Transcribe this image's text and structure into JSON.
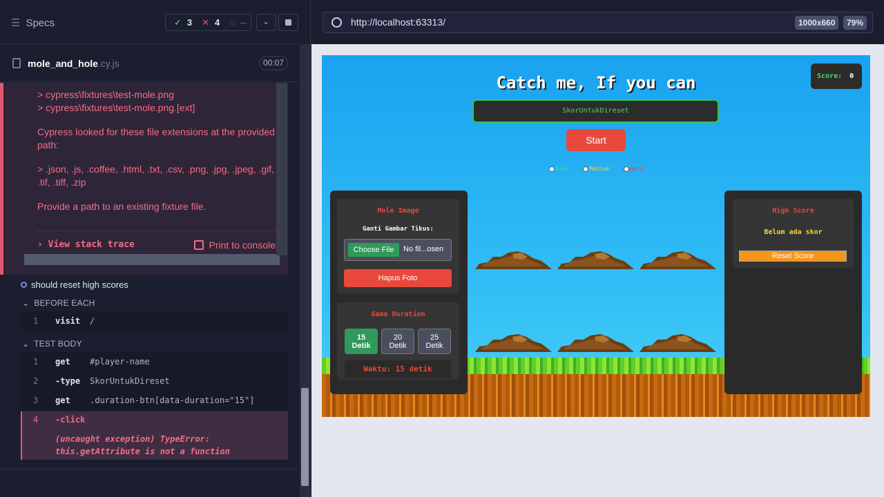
{
  "runner": {
    "specs_label": "Specs",
    "passed": "3",
    "failed": "4",
    "pending": "--",
    "file_name": "mole_and_hole",
    "file_ext": ".cy.js",
    "duration": "00:07",
    "error": {
      "lines": [
        "> cypress\\fixtures\\test-mole.png",
        "> cypress\\fixtures\\test-mole.png.[ext]"
      ],
      "para1": "Cypress looked for these file extensions at the provided path:",
      "para2": "> .json, .js, .coffee, .html, .txt, .csv, .png, .jpg, .jpeg, .gif, .tif, .tiff, .zip",
      "para3": "Provide a path to an existing fixture file.",
      "view_stack": "View stack trace",
      "print_console": "Print to console"
    },
    "test_title": "should reset high scores",
    "before_each_label": "BEFORE EACH",
    "test_body_label": "TEST BODY",
    "before_cmds": [
      {
        "n": "1",
        "cmd": "visit",
        "arg": "/"
      }
    ],
    "body_cmds": [
      {
        "n": "1",
        "cmd": "get",
        "arg": "#player-name"
      },
      {
        "n": "2",
        "cmd": "-type",
        "arg": "SkorUntukDireset"
      },
      {
        "n": "3",
        "cmd": "get",
        "arg": ".duration-btn[data-duration=\"15\"]"
      }
    ],
    "fail_cmd": {
      "n": "4",
      "cmd": "-click",
      "msg1": "(uncaught exception)  TypeError:",
      "msg2": "this.getAttribute is not a function"
    }
  },
  "browser": {
    "url": "http://localhost:63313/",
    "viewport": "1000x660",
    "zoom": "79%"
  },
  "app": {
    "title": "Catch me, If you can",
    "score_label": "Score:",
    "score_value": "0",
    "player_name": "SkorUntukDireset",
    "start_label": "Start",
    "difficulty": [
      {
        "label": "Easy",
        "color": "#2ee58a"
      },
      {
        "label": "Medium",
        "color": "#f5d442"
      },
      {
        "label": "Hard",
        "color": "#e8493c"
      }
    ],
    "mole_image_title": "Mole Image",
    "change_image_label": "Ganti Gambar Tikus:",
    "choose_file_label": "Choose File",
    "file_status": "No fil...osen",
    "delete_photo_label": "Hapus Foto",
    "game_duration_title": "Game Duration",
    "durations": [
      {
        "num": "15",
        "unit": "Detik"
      },
      {
        "num": "20",
        "unit": "Detik"
      },
      {
        "num": "25",
        "unit": "Detik"
      }
    ],
    "timer_text": "Waktu: 15 detik",
    "high_score_title": "High Score",
    "no_score_text": "Belum ada skor",
    "reset_score_label": "Reset Score"
  }
}
